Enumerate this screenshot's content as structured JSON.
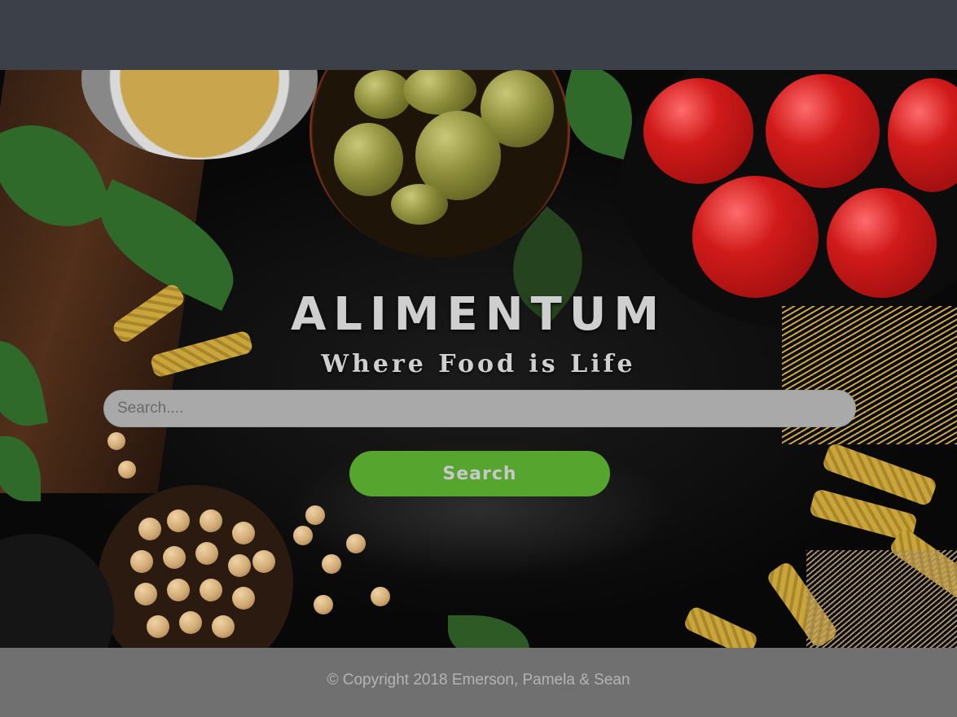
{
  "hero": {
    "title": "ALIMENTUM",
    "subtitle": "Where Food is Life",
    "background_image": "food-ingredients-photo"
  },
  "search": {
    "placeholder": "Search....",
    "value": "",
    "button_label": "Search"
  },
  "footer": {
    "copyright": "© Copyright 2018 Emerson, Pamela & Sean"
  },
  "colors": {
    "header_bar": "#3c4048",
    "search_button": "#56a52e",
    "search_input": "#a9a9a9",
    "footer": "#707070",
    "title_text": "#cfcfcf"
  }
}
